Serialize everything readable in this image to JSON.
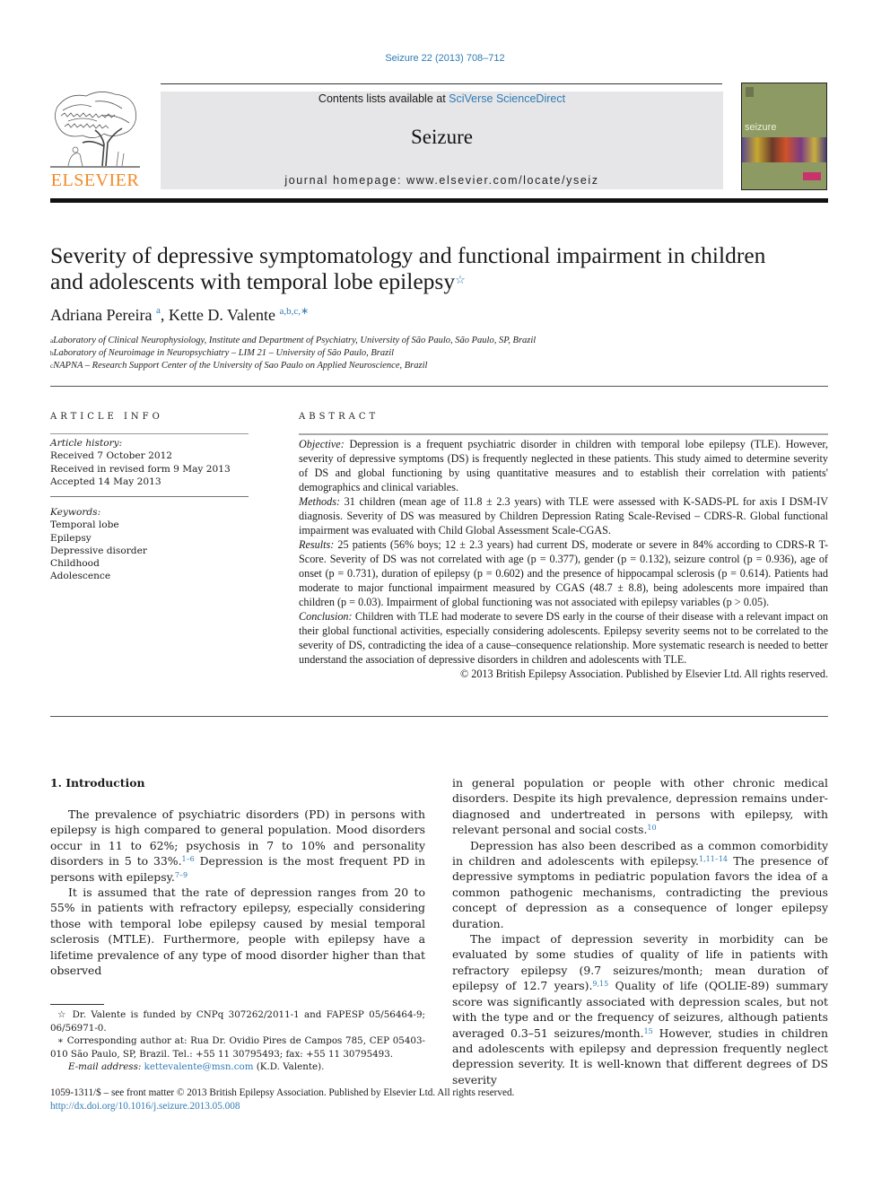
{
  "header": {
    "citation": "Seizure 22 (2013) 708–712",
    "contents_prefix": "Contents lists available at ",
    "contents_link": "SciVerse ScienceDirect",
    "journal_name": "Seizure",
    "homepage": "journal homepage: www.elsevier.com/locate/yseiz",
    "publisher_logo_text": "ELSEVIER",
    "cover_title": "seizure"
  },
  "colors": {
    "link": "#2f7bb5",
    "elsevier_orange": "#f28a28",
    "banner_bg": "#e6e6e8"
  },
  "article": {
    "title_line1": "Severity of depressive symptomatology and functional impairment in children",
    "title_line2": "and adolescents with temporal lobe epilepsy",
    "title_note_mark": "☆",
    "authors": [
      {
        "name": "Adriana Pereira",
        "marks": "a"
      },
      {
        "name": "Kette D. Valente",
        "marks": "a,b,c,∗"
      }
    ],
    "author_separator": ", ",
    "affiliations": [
      {
        "mark": "a",
        "text": "Laboratory of Clinical Neurophysiology, Institute and Department of Psychiatry, University of São Paulo, São Paulo, SP, Brazil"
      },
      {
        "mark": "b",
        "text": "Laboratory of Neuroimage in Neuropsychiatry – LIM 21 – University of São Paulo, Brazil"
      },
      {
        "mark": "c",
        "text": "NAPNA – Research Support Center of the University of Sao Paulo on Applied Neuroscience, Brazil"
      }
    ]
  },
  "article_info": {
    "heading": "ARTICLE INFO",
    "history_label": "Article history:",
    "history": [
      "Received 7 October 2012",
      "Received in revised form 9 May 2013",
      "Accepted 14 May 2013"
    ],
    "keywords_label": "Keywords:",
    "keywords": [
      "Temporal lobe",
      "Epilepsy",
      "Depressive disorder",
      "Childhood",
      "Adolescence"
    ]
  },
  "abstract": {
    "heading": "ABSTRACT",
    "sections": [
      {
        "label": "Objective:",
        "text": " Depression is a frequent psychiatric disorder in children with temporal lobe epilepsy (TLE). However, severity of depressive symptoms (DS) is frequently neglected in these patients. This study aimed to determine severity of DS and global functioning by using quantitative measures and to establish their correlation with patients' demographics and clinical variables."
      },
      {
        "label": "Methods:",
        "text": " 31 children (mean age of 11.8 ± 2.3 years) with TLE were assessed with K-SADS-PL for axis I DSM-IV diagnosis. Severity of DS was measured by Children Depression Rating Scale-Revised – CDRS-R. Global functional impairment was evaluated with Child Global Assessment Scale-CGAS."
      },
      {
        "label": "Results:",
        "text": " 25 patients (56% boys; 12 ± 2.3 years) had current DS, moderate or severe in 84% according to CDRS-R T-Score. Severity of DS was not correlated with age (p = 0.377), gender (p = 0.132), seizure control (p = 0.936), age of onset (p = 0.731), duration of epilepsy (p = 0.602) and the presence of hippocampal sclerosis (p = 0.614). Patients had moderate to major functional impairment measured by CGAS (48.7 ± 8.8), being adolescents more impaired than children (p = 0.03). Impairment of global functioning was not associated with epilepsy variables (p > 0.05)."
      },
      {
        "label": "Conclusion:",
        "text": " Children with TLE had moderate to severe DS early in the course of their disease with a relevant impact on their global functional activities, especially considering adolescents. Epilepsy severity seems not to be correlated to the severity of DS, contradicting the idea of a cause–consequence relationship. More systematic research is needed to better understand the association of depressive disorders in children and adolescents with TLE."
      }
    ],
    "copyright": "© 2013 British Epilepsy Association. Published by Elsevier Ltd. All rights reserved."
  },
  "body": {
    "section_heading": "1.  Introduction",
    "left_paragraphs": [
      {
        "parts": [
          {
            "t": "The prevalence of psychiatric disorders (PD) in persons with epilepsy is high compared to general population. Mood disorders occur in 11 to 62%; psychosis in 7 to 10% and personality disorders in 5 to 33%."
          },
          {
            "ref": "1–6"
          },
          {
            "t": " Depression is the most frequent PD in persons with epilepsy."
          },
          {
            "ref": "7–9"
          }
        ]
      },
      {
        "parts": [
          {
            "t": "It is assumed that the rate of depression ranges from 20 to 55% in patients with refractory epilepsy, especially considering those with temporal lobe epilepsy caused by mesial temporal sclerosis (MTLE). Furthermore, people with epilepsy have a lifetime prevalence of any type of mood disorder higher than that observed"
          }
        ]
      }
    ],
    "right_paragraphs": [
      {
        "noindent": true,
        "parts": [
          {
            "t": "in general population or people with other chronic medical disorders. Despite its high prevalence, depression remains under-diagnosed and undertreated in persons with epilepsy, with relevant personal and social costs."
          },
          {
            "ref": "10"
          }
        ]
      },
      {
        "parts": [
          {
            "t": "Depression has also been described as a common comorbidity in children and adolescents with epilepsy."
          },
          {
            "ref": "1,11–14"
          },
          {
            "t": " The presence of depressive symptoms in pediatric population favors the idea of a common pathogenic mechanisms, contradicting the previous concept of depression as a consequence of longer epilepsy duration."
          }
        ]
      },
      {
        "parts": [
          {
            "t": "The impact of depression severity in morbidity can be evaluated by some studies of quality of life in patients with refractory epilepsy (9.7 seizures/month; mean duration of epilepsy of 12.7 years)."
          },
          {
            "ref": "9,15"
          },
          {
            "t": " Quality of life (QOLIE-89) summary score was significantly associated with depression scales, but not with the type and or the frequency of seizures, although patients averaged 0.3–51 seizures/month."
          },
          {
            "ref": "15"
          },
          {
            "t": " However, studies in children and adolescents with epilepsy and depression frequently neglect depression severity. It is well-known that different degrees of DS severity"
          }
        ]
      }
    ]
  },
  "footnotes": {
    "funding_mark": "☆",
    "funding": " Dr. Valente is funded by CNPq 307262/2011-1 and FAPESP 05/56464-9; 06/56971-0.",
    "corresponding_mark": "∗",
    "corresponding": " Corresponding author at: Rua Dr. Ovidio Pires de Campos 785, CEP 05403-010 São Paulo, SP, Brazil. Tel.: +55 11 30795493; fax: +55 11 30795493.",
    "email_label": "E-mail address:",
    "email": "kettevalente@msn.com",
    "email_suffix": " (K.D. Valente)."
  },
  "footer": {
    "front_matter": "1059-1311/$ – see front matter © 2013 British Epilepsy Association. Published by Elsevier Ltd. All rights reserved.",
    "doi": "http://dx.doi.org/10.1016/j.seizure.2013.05.008"
  }
}
